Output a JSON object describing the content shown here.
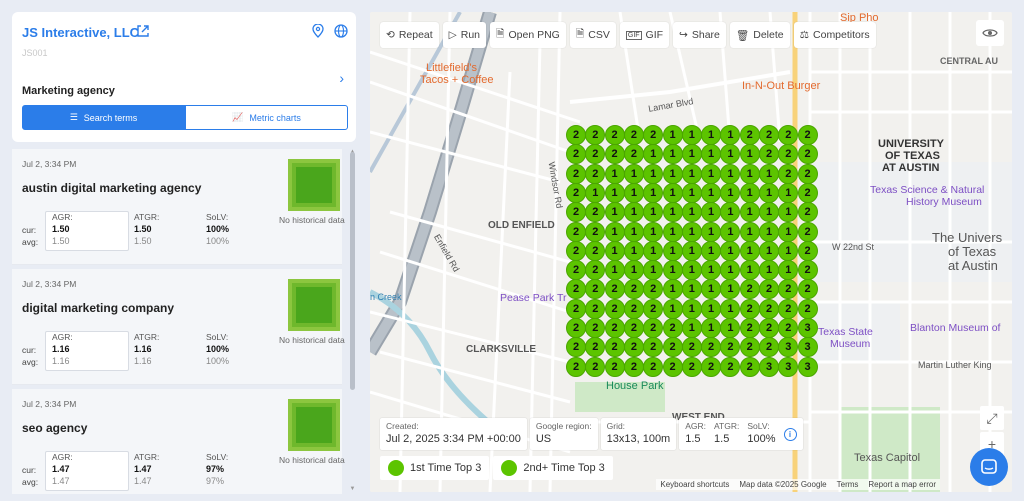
{
  "company": {
    "name": "JS Interactive, LLC",
    "code": "JS001",
    "category": "Marketing agency"
  },
  "tabs": {
    "search_terms": "Search terms",
    "metric_charts": "Metric charts"
  },
  "labels": {
    "cur": "cur:",
    "avg": "avg:",
    "agr": "AGR:",
    "atgr": "ATGR:",
    "solv": "SoLV:",
    "no_hist": "No historical data"
  },
  "items": [
    {
      "date": "Jul 2, 3:34 PM",
      "keyword": "austin digital marketing agency",
      "agr_cur": "1.50",
      "agr_avg": "1.50",
      "atgr_cur": "1.50",
      "atgr_avg": "1.50",
      "solv_cur": "100%",
      "solv_avg": "100%"
    },
    {
      "date": "Jul 2, 3:34 PM",
      "keyword": "digital marketing company",
      "agr_cur": "1.16",
      "agr_avg": "1.16",
      "atgr_cur": "1.16",
      "atgr_avg": "1.16",
      "solv_cur": "100%",
      "solv_avg": "100%"
    },
    {
      "date": "Jul 2, 3:34 PM",
      "keyword": "seo agency",
      "agr_cur": "1.47",
      "agr_avg": "1.47",
      "atgr_cur": "1.47",
      "atgr_avg": "1.47",
      "solv_cur": "97%",
      "solv_avg": "97%"
    }
  ],
  "toolbar": {
    "repeat": "Repeat",
    "run": "Run",
    "open_png": "Open PNG",
    "csv": "CSV",
    "gif": "GIF",
    "share": "Share",
    "delete": "Delete",
    "competitors": "Competitors"
  },
  "grid": {
    "size": 13,
    "ranks": [
      "2222211112222",
      "2222111111222",
      "2211111111122",
      "2111111111112",
      "2211111111112",
      "2211111111112",
      "2211111111112",
      "2211111111112",
      "2222211112222",
      "2222211112222",
      "2222221112223",
      "2222222222233",
      "2222222222333"
    ]
  },
  "map_labels": {
    "sip_pho": "Sip Pho",
    "central_au": "CENTRAL AU",
    "littlefield": "Littlefield's",
    "tacos": "Tacos + Coffee",
    "in_n_out": "In-N-Out Burger",
    "lamar": "Lamar Blvd",
    "ut1": "UNIVERSITY",
    "ut2": "OF TEXAS",
    "ut3": "AT AUSTIN",
    "txsci1": "Texas Science & Natural",
    "txsci2": "History Museum",
    "utb1": "The Univers",
    "utb2": "of Texas",
    "utb3": "at Austin",
    "old_enfield": "OLD ENFIELD",
    "pease": "Pease Park Tr",
    "clarksville": "CLARKSVILLE",
    "house_park": "House Park",
    "texas_state": "Texas State",
    "museum": "Museum",
    "blanton": "Blanton Museum of",
    "mlk": "Martin Luther King",
    "west_end": "WEST END",
    "capitol": "Texas Capitol",
    "creek": "n Creek",
    "enfield_rd": "Enfield Rd",
    "windsor": "Windsor Rd",
    "w22": "W 22nd St"
  },
  "info": {
    "created_label": "Created:",
    "created_value": "Jul 2, 2025 3:34 PM +00:00",
    "region_label": "Google region:",
    "region_value": "US",
    "grid_label": "Grid:",
    "grid_value": "13x13, 100m",
    "agr_label": "AGR:",
    "agr_value": "1.5",
    "atgr_label": "ATGR:",
    "atgr_value": "1.5",
    "solv_label": "SoLV:",
    "solv_value": "100%"
  },
  "legend": {
    "first": "1st Time Top 3",
    "second": "2nd+ Time Top 3"
  },
  "attribution": {
    "shortcuts": "Keyboard shortcuts",
    "mapdata": "Map data ©2025 Google",
    "terms": "Terms",
    "report": "Report a map error"
  },
  "colors": {
    "accent": "#2b7de9",
    "rank_green": "#5cc400"
  }
}
